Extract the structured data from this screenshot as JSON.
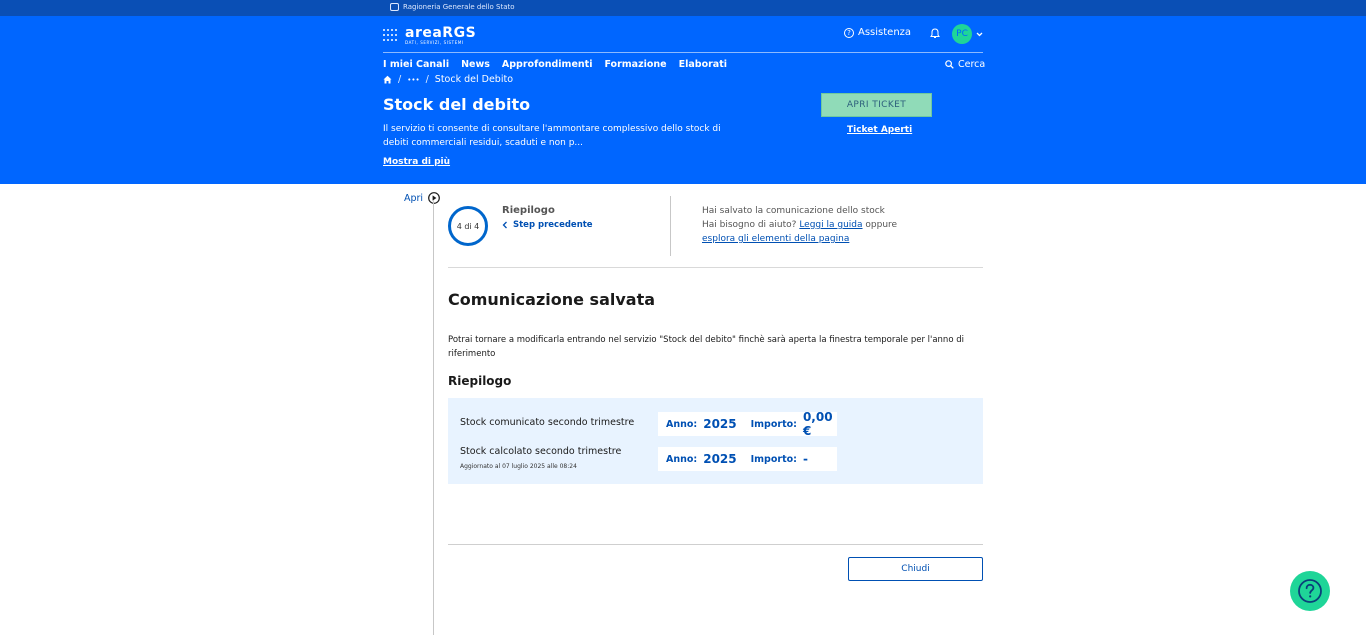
{
  "topbar": {
    "org": "Ragioneria Generale dello Stato"
  },
  "header": {
    "logo_name": "areaRGS",
    "logo_tag": "DATI, SERVIZI, SISTEMI",
    "assist_label": "Assistenza",
    "avatar_initials": "PC",
    "nav": [
      "I miei Canali",
      "News",
      "Approfondimenti",
      "Formazione",
      "Elaborati"
    ],
    "search_label": "Cerca",
    "breadcrumb": {
      "sep": "/",
      "ellipsis": "•••",
      "current": "Stock del Debito"
    },
    "title": "Stock del debito",
    "description": "Il servizio ti consente di consultare l'ammontare complessivo dello stock di debiti commerciali residui, scaduti e non p...",
    "more_label": "Mostra di più",
    "ticket_button": "APRI TICKET",
    "ticket_open": "Ticket Aperti"
  },
  "sidebar": {
    "toggle_label": "Apri"
  },
  "stepper": {
    "progress": "4 di 4",
    "title": "Riepilogo",
    "prev_label": "Step precedente"
  },
  "help": {
    "line1": "Hai salvato la comunicazione dello stock",
    "line2_prefix": "Hai bisogno di aiuto?",
    "guide_link": "Leggi la guida",
    "line2_suffix": "oppure",
    "explore_link": "esplora gli elementi della pagina"
  },
  "main": {
    "heading": "Comunicazione salvata",
    "body": "Potrai tornare a modificarla entrando nel servizio \"Stock del debito\" finchè sarà aperta la finestra temporale per l'anno di riferimento",
    "subheading": "Riepilogo",
    "rows": [
      {
        "label": "Stock comunicato secondo trimestre",
        "sub": "",
        "anno_label": "Anno:",
        "anno": "2025",
        "importo_label": "Importo:",
        "importo": "0,00 €"
      },
      {
        "label": "Stock calcolato secondo trimestre",
        "sub": "Aggiornato al 07 luglio 2025 alle 08:24",
        "anno_label": "Anno:",
        "anno": "2025",
        "importo_label": "Importo:",
        "importo": "-"
      }
    ],
    "close_button": "Chiudi"
  }
}
